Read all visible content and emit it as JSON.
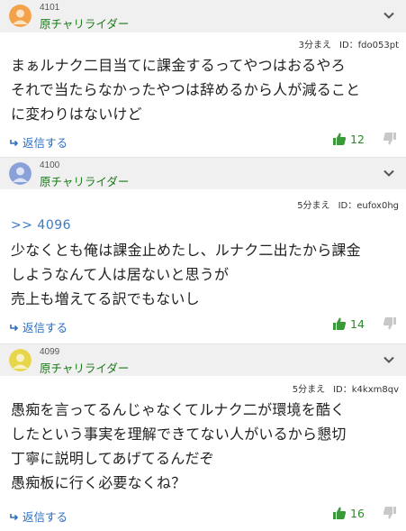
{
  "posts": [
    {
      "number": "4101",
      "user": "原チャリライダー",
      "avatar_color": "#f4a24a",
      "time": "3分まえ",
      "id_label": "ID：fdo053pt",
      "anchor": "",
      "lines": [
        "まぁルナク二目当てに課金するってやつはおるやろ",
        "それで当たらなかったやつは辞めるから人が減ること",
        "に変わりはないけど"
      ],
      "reply_label": "返信する",
      "likes": "12"
    },
    {
      "number": "4100",
      "user": "原チャリライダー",
      "avatar_color": "#8aa0d8",
      "time": "5分まえ",
      "id_label": "ID：eufox0hg",
      "anchor": ">> 4096",
      "lines": [
        "少なくとも俺は課金止めたし、ルナク二出たから課金",
        "しようなんて人は居ないと思うが",
        "売上も増えてる訳でもないし"
      ],
      "reply_label": "返信する",
      "likes": "14"
    },
    {
      "number": "4099",
      "user": "原チャリライダー",
      "avatar_color": "#e8d64a",
      "time": "5分まえ",
      "id_label": "ID：k4kxm8qv",
      "anchor": "",
      "lines": [
        "愚痴を言ってるんじゃなくてルナク二が環境を酷く",
        "したという事実を理解できてない人がいるから懇切",
        "丁寧に説明してあげてるんだぞ",
        "愚痴板に行く必要なくね？"
      ],
      "reply_label": "返信する",
      "likes": "16"
    }
  ],
  "colors": {
    "user_name": "#1a7a1a",
    "reply_link": "#2d6fbf",
    "like": "#2a8a2a",
    "header_bg": "#f0f0f0"
  },
  "icons": {
    "avatar": "person-icon",
    "menu": "chevron-down-icon",
    "reply": "reply-arrow-icon",
    "like": "thumbs-up-icon",
    "dislike": "thumbs-down-icon"
  }
}
